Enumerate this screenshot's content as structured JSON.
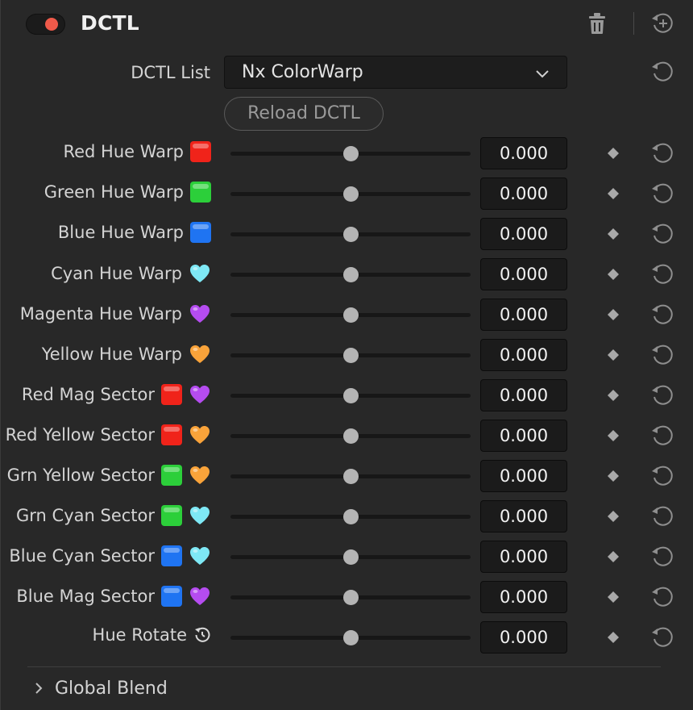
{
  "header": {
    "title": "DCTL",
    "toggle_color": "#ef5a4a"
  },
  "dctl_list": {
    "label": "DCTL List",
    "selected": "Nx ColorWarp"
  },
  "reload_label": "Reload DCTL",
  "params": [
    {
      "label": "Red Hue Warp",
      "icons": [
        "red-square"
      ],
      "value": "0.000",
      "slider": 0.5
    },
    {
      "label": "Green Hue Warp",
      "icons": [
        "green-square"
      ],
      "value": "0.000",
      "slider": 0.5
    },
    {
      "label": "Blue Hue Warp",
      "icons": [
        "blue-square"
      ],
      "value": "0.000",
      "slider": 0.5
    },
    {
      "label": "Cyan Hue Warp",
      "icons": [
        "cyan-heart"
      ],
      "value": "0.000",
      "slider": 0.5
    },
    {
      "label": "Magenta Hue Warp",
      "icons": [
        "purple-heart"
      ],
      "value": "0.000",
      "slider": 0.5
    },
    {
      "label": "Yellow Hue Warp",
      "icons": [
        "orange-heart"
      ],
      "value": "0.000",
      "slider": 0.5
    },
    {
      "label": "Red Mag Sector",
      "icons": [
        "red-square",
        "purple-heart"
      ],
      "value": "0.000",
      "slider": 0.5
    },
    {
      "label": "Red Yellow Sector",
      "icons": [
        "red-square",
        "orange-heart"
      ],
      "value": "0.000",
      "slider": 0.5
    },
    {
      "label": "Grn Yellow Sector",
      "icons": [
        "green-square",
        "orange-heart"
      ],
      "value": "0.000",
      "slider": 0.5
    },
    {
      "label": "Grn Cyan Sector",
      "icons": [
        "green-square",
        "cyan-heart"
      ],
      "value": "0.000",
      "slider": 0.5
    },
    {
      "label": "Blue Cyan Sector",
      "icons": [
        "blue-square",
        "cyan-heart"
      ],
      "value": "0.000",
      "slider": 0.5
    },
    {
      "label": "Blue Mag Sector",
      "icons": [
        "blue-square",
        "purple-heart"
      ],
      "value": "0.000",
      "slider": 0.5
    },
    {
      "label": "Hue Rotate",
      "icons": [
        "rotate-icon"
      ],
      "value": "0.000",
      "slider": 0.5
    }
  ],
  "colors": {
    "red-square": "#f0231a",
    "green-square": "#2ccf3a",
    "blue-square": "#1f74f2",
    "cyan-heart": "#7ee8f5",
    "purple-heart": "#b54cf0",
    "orange-heart": "#f9a33a"
  },
  "footer": {
    "global_blend_label": "Global Blend"
  }
}
